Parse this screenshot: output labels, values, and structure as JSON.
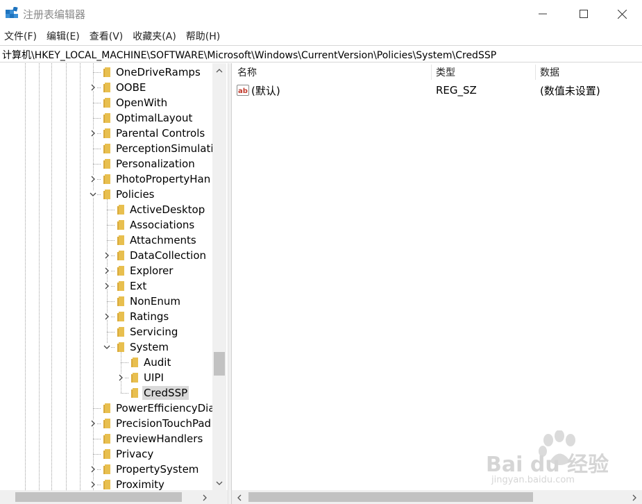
{
  "window": {
    "title": "注册表编辑器"
  },
  "menu": [
    {
      "label": "文件(F)"
    },
    {
      "label": "编辑(E)"
    },
    {
      "label": "查看(V)"
    },
    {
      "label": "收藏夹(A)"
    },
    {
      "label": "帮助(H)"
    }
  ],
  "address": {
    "path": "计算机\\HKEY_LOCAL_MACHINE\\SOFTWARE\\Microsoft\\Windows\\CurrentVersion\\Policies\\System\\CredSSP"
  },
  "tree": {
    "nodes": [
      {
        "label": "OneDriveRamps",
        "depth": 0,
        "expander": "none"
      },
      {
        "label": "OOBE",
        "depth": 0,
        "expander": "collapsed"
      },
      {
        "label": "OpenWith",
        "depth": 0,
        "expander": "none"
      },
      {
        "label": "OptimalLayout",
        "depth": 0,
        "expander": "none"
      },
      {
        "label": "Parental Controls",
        "depth": 0,
        "expander": "collapsed"
      },
      {
        "label": "PerceptionSimulati",
        "depth": 0,
        "expander": "none"
      },
      {
        "label": "Personalization",
        "depth": 0,
        "expander": "none"
      },
      {
        "label": "PhotoPropertyHan",
        "depth": 0,
        "expander": "collapsed"
      },
      {
        "label": "Policies",
        "depth": 0,
        "expander": "expanded"
      },
      {
        "label": "ActiveDesktop",
        "depth": 1,
        "expander": "none"
      },
      {
        "label": "Associations",
        "depth": 1,
        "expander": "none"
      },
      {
        "label": "Attachments",
        "depth": 1,
        "expander": "none"
      },
      {
        "label": "DataCollection",
        "depth": 1,
        "expander": "collapsed"
      },
      {
        "label": "Explorer",
        "depth": 1,
        "expander": "collapsed"
      },
      {
        "label": "Ext",
        "depth": 1,
        "expander": "collapsed"
      },
      {
        "label": "NonEnum",
        "depth": 1,
        "expander": "none"
      },
      {
        "label": "Ratings",
        "depth": 1,
        "expander": "collapsed"
      },
      {
        "label": "Servicing",
        "depth": 1,
        "expander": "none"
      },
      {
        "label": "System",
        "depth": 1,
        "expander": "expanded"
      },
      {
        "label": "Audit",
        "depth": 2,
        "expander": "none"
      },
      {
        "label": "UIPI",
        "depth": 2,
        "expander": "collapsed"
      },
      {
        "label": "CredSSP",
        "depth": 2,
        "expander": "none",
        "selected": true
      },
      {
        "label": "PowerEfficiencyDia",
        "depth": 0,
        "expander": "none"
      },
      {
        "label": "PrecisionTouchPad",
        "depth": 0,
        "expander": "collapsed"
      },
      {
        "label": "PreviewHandlers",
        "depth": 0,
        "expander": "none"
      },
      {
        "label": "Privacy",
        "depth": 0,
        "expander": "none"
      },
      {
        "label": "PropertySystem",
        "depth": 0,
        "expander": "collapsed"
      },
      {
        "label": "Proximity",
        "depth": 0,
        "expander": "collapsed"
      }
    ]
  },
  "list": {
    "columns": [
      {
        "label": "名称"
      },
      {
        "label": "类型"
      },
      {
        "label": "数据"
      }
    ],
    "rows": [
      {
        "name": "(默认)",
        "type": "REG_SZ",
        "data": "(数值未设置)",
        "icon": "string-value-icon"
      }
    ]
  },
  "watermark": {
    "brand": "Bai du 经验",
    "url": "jingyan.baidu.com"
  },
  "colors": {
    "folder": "#e8bf4f",
    "selection": "#d9d9d9",
    "scrollbar_track": "#f0f0f0",
    "scrollbar_thumb": "#c2c2c2",
    "app_icon": "#1e73be"
  }
}
